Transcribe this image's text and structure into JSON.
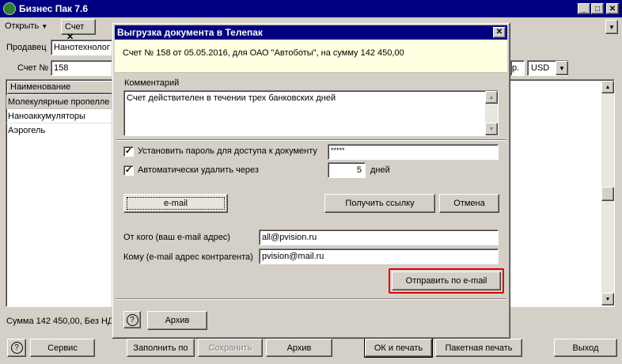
{
  "app": {
    "title": "Бизнес Пак 7.6",
    "menu_open": "Открыть",
    "tab_label": "Счет",
    "seller_label": "Продавец",
    "seller_value": "Нанотехнолог",
    "invoice_label": "Счет №",
    "invoice_value": "158",
    "currency_fragment": "р.",
    "currency": "USD",
    "list_header": "Наименование",
    "items": [
      "Молекулярные пропелле",
      "Наноаккумуляторы",
      "Аэрогель"
    ],
    "sum_text": "Сумма 142 450,00, Без НД",
    "bottom_buttons": {
      "help": "?",
      "service": "Сервис",
      "fill": "Заполнить по",
      "save": "Сохранить",
      "archive": "Архив",
      "ok_print": "ОК и печать",
      "batch_print": "Пакетная печать",
      "exit": "Выход"
    }
  },
  "dialog": {
    "title": "Выгрузка документа в Телепак",
    "info": "Счет № 158 от 05.05.2016, для ОАО \"Автоботы\", на сумму 142 450,00",
    "comment_label": "Комментарий",
    "comment_value": "Счет действителен в течении трех банковских дней",
    "password_check_label": "Установить пароль для доступа к документу",
    "password_checked": true,
    "password_value": "*****",
    "autodelete_label": "Автоматически удалить через",
    "autodelete_checked": true,
    "autodelete_days": "5",
    "days_label": "дней",
    "email_button": "e-mail",
    "get_link_button": "Получить ссылку",
    "cancel_button": "Отмена",
    "from_label": "От кого (ваш e-mail адрес)",
    "from_value": "all@pvision.ru",
    "to_label": "Кому (e-mail адрес контрагента)",
    "to_value": "pvision@mail.ru",
    "send_button": "Отправить по e-mail",
    "help_button": "?",
    "archive_button": "Архив",
    "highlight_color": "#e00000"
  }
}
